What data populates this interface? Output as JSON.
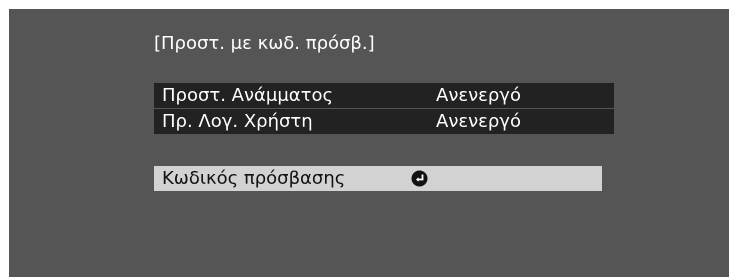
{
  "menu": {
    "title": "[Προστ. με κωδ. πρόσβ.]",
    "settings": [
      {
        "label": "Προστ. Ανάμματος",
        "value": "Ανενεργό"
      },
      {
        "label": "Πρ. Λογ. Χρήστη",
        "value": "Ανενεργό"
      }
    ],
    "passcode": {
      "label": "Κωδικός πρόσβασης",
      "icon": "enter-icon"
    }
  },
  "colors": {
    "screen_background": "#555555",
    "row_background": "#222222",
    "highlight_background": "#d2d2d2",
    "text": "#ffffff"
  }
}
